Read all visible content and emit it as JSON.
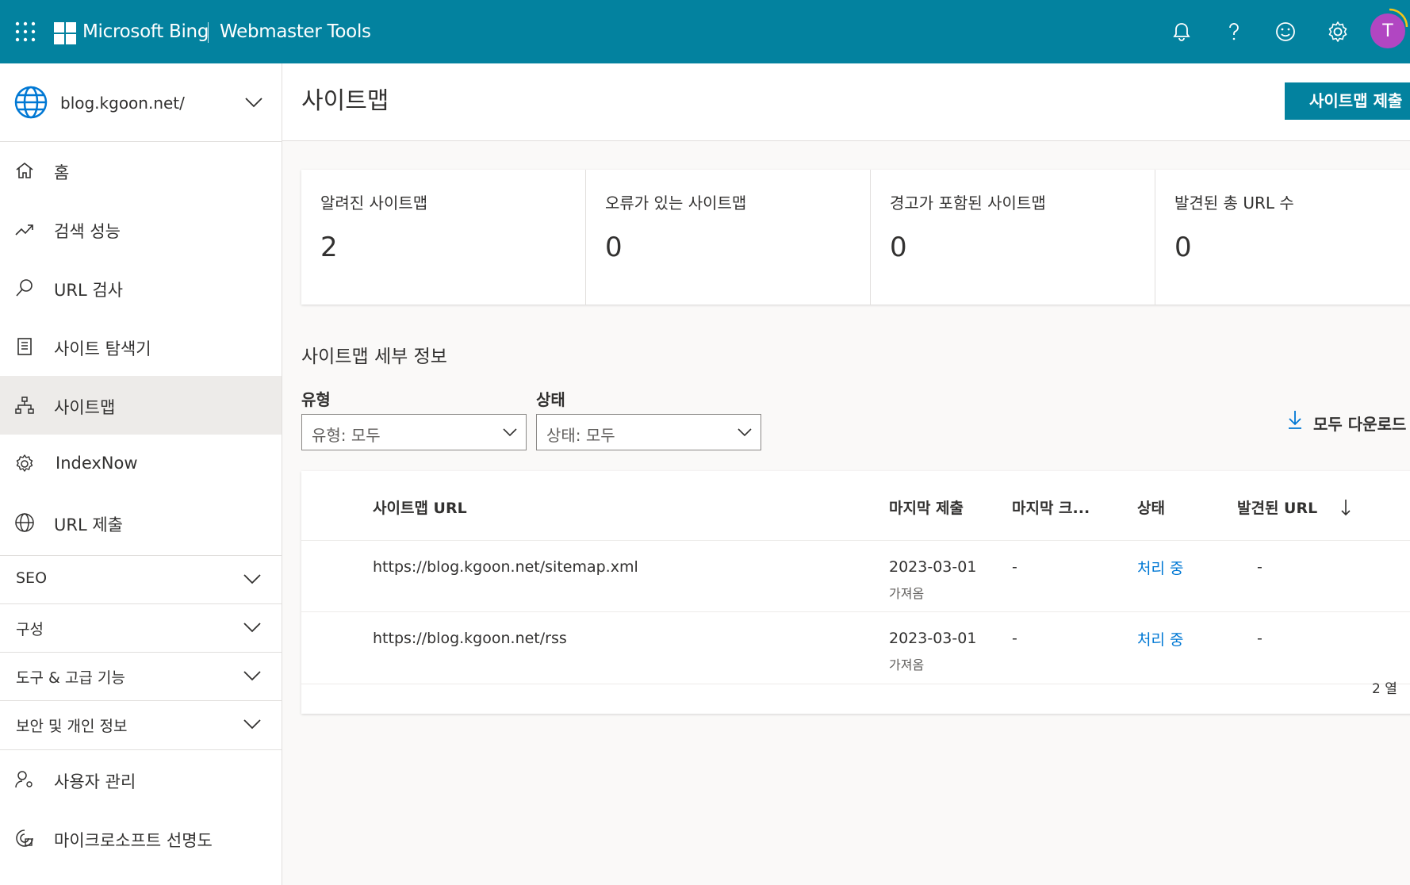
{
  "header": {
    "brand": "Microsoft Bing",
    "product": "Webmaster Tools",
    "avatar_initial": "T",
    "icons": [
      "waffle-icon",
      "bell-icon",
      "help-icon",
      "feedback-smile-icon",
      "gear-icon"
    ]
  },
  "sidebar": {
    "site": "blog.kgoon.net/",
    "items": [
      {
        "label": "홈",
        "icon": "home-icon"
      },
      {
        "label": "검색 성능",
        "icon": "trend-icon"
      },
      {
        "label": "URL 검사",
        "icon": "search-icon"
      },
      {
        "label": "사이트 탐색기",
        "icon": "explorer-icon"
      },
      {
        "label": "사이트맵",
        "icon": "sitemap-icon"
      },
      {
        "label": "IndexNow",
        "icon": "gear-icon"
      },
      {
        "label": "URL 제출",
        "icon": "globe-icon"
      }
    ],
    "groups": [
      {
        "label": "SEO"
      },
      {
        "label": "구성"
      },
      {
        "label": "도구 & 고급 기능"
      },
      {
        "label": "보안 및 개인 정보"
      }
    ],
    "bottom_items": [
      {
        "label": "사용자 관리",
        "icon": "user-settings-icon"
      },
      {
        "label": "마이크로소프트 선명도",
        "icon": "clarity-icon"
      }
    ]
  },
  "main": {
    "title": "사이트맵",
    "submit_button": "사이트맵 제출",
    "stats": [
      {
        "label": "알려진 사이트맵",
        "value": "2"
      },
      {
        "label": "오류가 있는 사이트맵",
        "value": "0"
      },
      {
        "label": "경고가 포함된 사이트맵",
        "value": "0"
      },
      {
        "label": "발견된 총 URL 수",
        "value": "0"
      }
    ],
    "details_title": "사이트맵 세부 정보",
    "filters": {
      "type_label": "유형",
      "type_value": "유형: 모두",
      "status_label": "상태",
      "status_value": "상태: 모두"
    },
    "download_label": "모두 다운로드",
    "table": {
      "columns": [
        "사이트맵 URL",
        "마지막 제출",
        "마지막 크...",
        "상태",
        "발견된 URL"
      ],
      "rows": [
        {
          "url": "https://blog.kgoon.net/sitemap.xml",
          "last_submitted": "2023-03-01",
          "submitted_sub": "가져옴",
          "last_crawled": "-",
          "status": "처리 중",
          "urls": "-"
        },
        {
          "url": "https://blog.kgoon.net/rss",
          "last_submitted": "2023-03-01",
          "submitted_sub": "가져옴",
          "last_crawled": "-",
          "status": "처리 중",
          "urls": "-"
        }
      ],
      "footer": "2 열"
    }
  },
  "colors": {
    "header_bg": "#03829f",
    "accent": "#03829f",
    "link": "#0078d4",
    "avatar_bg": "#b146c2"
  }
}
